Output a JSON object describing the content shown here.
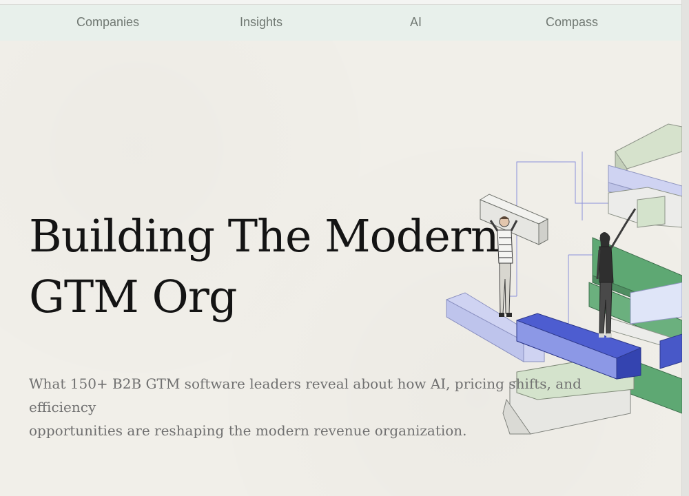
{
  "nav": {
    "items": [
      {
        "label": "Companies"
      },
      {
        "label": "Insights"
      },
      {
        "label": "AI"
      },
      {
        "label": "Compass"
      }
    ]
  },
  "hero": {
    "title_line1": "Building The Modern",
    "title_line2": "GTM Org",
    "subtitle_line1": "What 150+ B2B GTM software leaders reveal about how AI, pricing shifts, and efficiency",
    "subtitle_line2": "opportunities are reshaping the modern revenue organization."
  },
  "illustration": {
    "icon": "stacked-blocks-with-people-illustration",
    "colors": {
      "green": "#5da872",
      "pale_green": "#d4e3cc",
      "blue": "#4858c8",
      "lavender": "#cfd3f2",
      "gray": "#e8e8e4",
      "line": "#8088d8"
    }
  }
}
